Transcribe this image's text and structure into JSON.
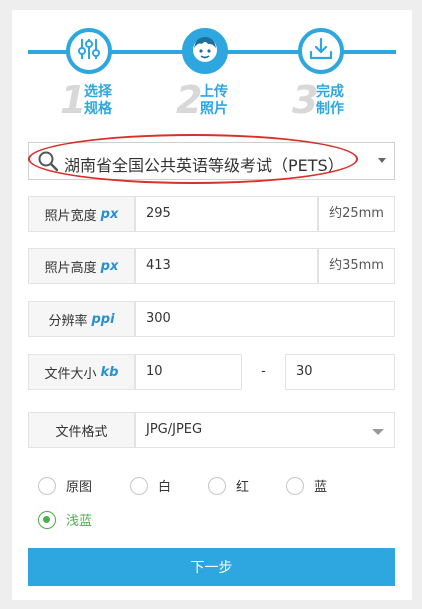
{
  "steps": [
    {
      "num": "1",
      "line1": "选择",
      "line2": "规格",
      "icon": "sliders-icon"
    },
    {
      "num": "2",
      "line1": "上传",
      "line2": "照片",
      "icon": "face-icon"
    },
    {
      "num": "3",
      "line1": "完成",
      "line2": "制作",
      "icon": "download-icon"
    }
  ],
  "exam": {
    "value": "湖南省全国公共英语等级考试（PETS）",
    "icon": "search-icon"
  },
  "width": {
    "label": "照片宽度",
    "unit": "px",
    "value": "295",
    "suffix": "约25mm"
  },
  "height": {
    "label": "照片高度",
    "unit": "px",
    "value": "413",
    "suffix": "约35mm"
  },
  "resolution": {
    "label": "分辨率",
    "unit": "ppi",
    "value": "300"
  },
  "filesize": {
    "label": "文件大小",
    "unit": "kb",
    "min": "10",
    "dash": "-",
    "max": "30"
  },
  "format": {
    "label": "文件格式",
    "value": "JPG/JPEG"
  },
  "backgrounds": [
    {
      "label": "原图",
      "checked": false
    },
    {
      "label": "白",
      "checked": false
    },
    {
      "label": "红",
      "checked": false
    },
    {
      "label": "蓝",
      "checked": false
    },
    {
      "label": "浅蓝",
      "checked": true
    }
  ],
  "next_label": "下一步",
  "colors": {
    "accent": "#2ea7e0",
    "checked": "#4cae4c",
    "highlight": "#d9302a"
  }
}
